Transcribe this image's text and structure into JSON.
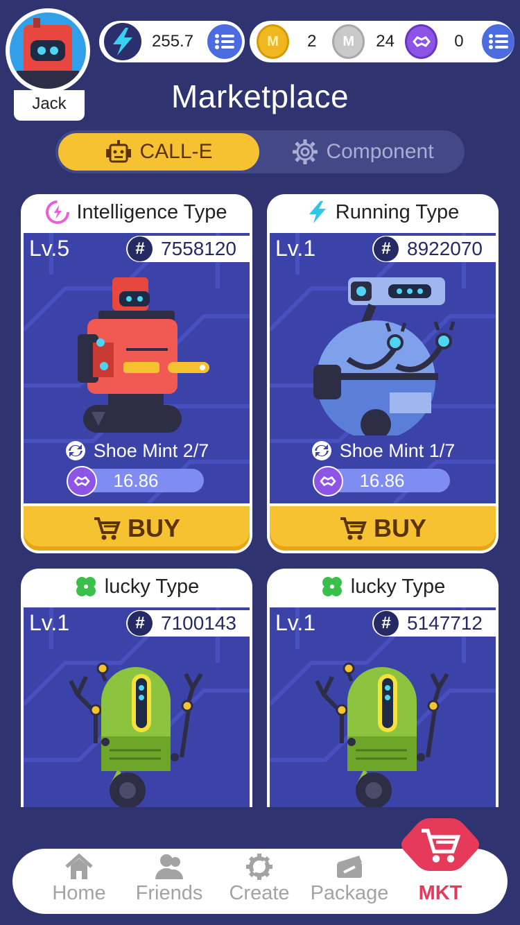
{
  "user": {
    "name": "Jack"
  },
  "balances": {
    "energy": "255.7",
    "gold": "2",
    "silver": "24",
    "polygon": "0",
    "gold_symbol": "M",
    "silver_symbol": "M"
  },
  "page": {
    "title": "Marketplace"
  },
  "tabs": [
    {
      "label": "CALL-E",
      "active": true
    },
    {
      "label": "Component",
      "active": false
    }
  ],
  "cards": [
    {
      "type": "Intelligence Type",
      "type_icon": "intelligence-icon",
      "level": "Lv.5",
      "id": "7558120",
      "mint": "Shoe Mint 2/7",
      "price": "16.86",
      "buy_label": "BUY",
      "robot": "red-robot"
    },
    {
      "type": "Running Type",
      "type_icon": "lightning-icon",
      "level": "Lv.1",
      "id": "8922070",
      "mint": "Shoe Mint 1/7",
      "price": "16.86",
      "buy_label": "BUY",
      "robot": "blue-robot"
    },
    {
      "type": "lucky Type",
      "type_icon": "clover-icon",
      "level": "Lv.1",
      "id": "7100143",
      "robot": "green-robot"
    },
    {
      "type": "lucky Type",
      "type_icon": "clover-icon",
      "level": "Lv.1",
      "id": "5147712",
      "robot": "green-robot"
    }
  ],
  "hash_symbol": "#",
  "nav": {
    "items": [
      {
        "label": "Home",
        "icon": "home-icon"
      },
      {
        "label": "Friends",
        "icon": "friends-icon"
      },
      {
        "label": "Create",
        "icon": "create-gear-icon"
      },
      {
        "label": "Package",
        "icon": "package-icon"
      },
      {
        "label": "MKT",
        "icon": "cart-icon",
        "active": true
      }
    ]
  },
  "colors": {
    "background": "#2f3470",
    "accent_yellow": "#f6c232",
    "card_blue": "#3b42a8",
    "mkt_red": "#e53a5a",
    "menu_blue": "#4c6be0"
  }
}
